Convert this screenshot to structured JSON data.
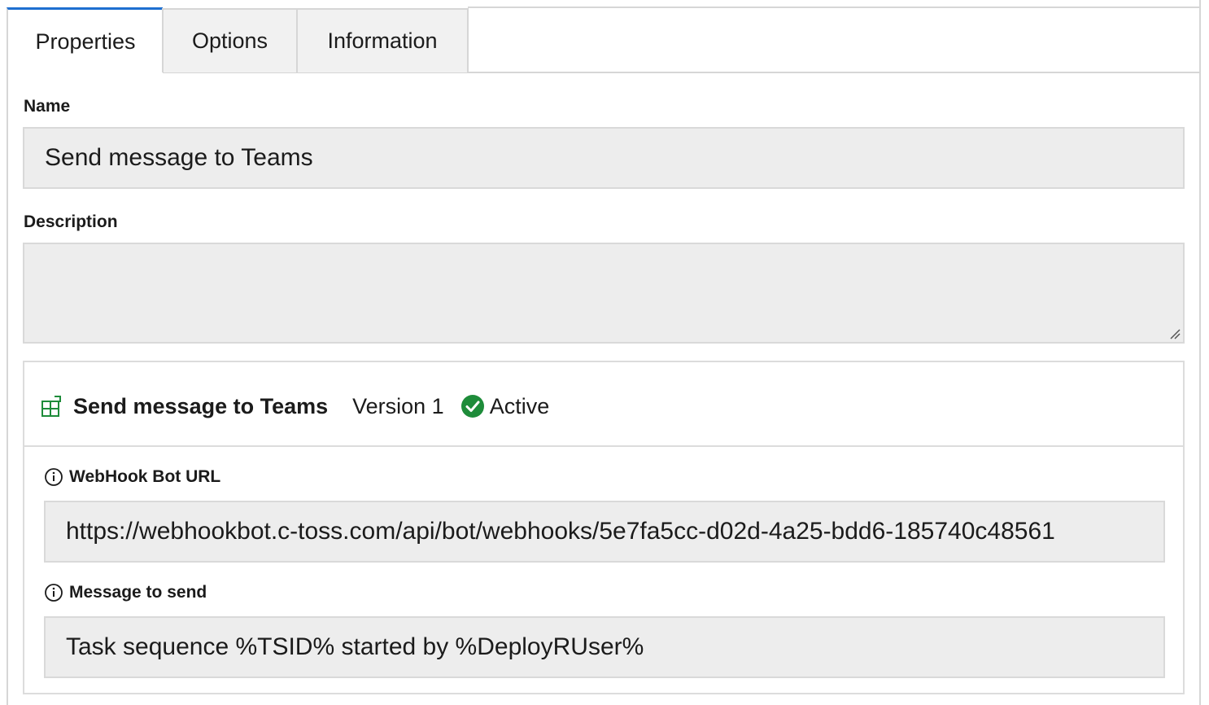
{
  "tabs": [
    {
      "label": "Properties",
      "active": true
    },
    {
      "label": "Options",
      "active": false
    },
    {
      "label": "Information",
      "active": false
    }
  ],
  "name_field": {
    "label": "Name",
    "value": "Send message to Teams"
  },
  "description_field": {
    "label": "Description",
    "value": ""
  },
  "step": {
    "icon": "package-icon",
    "title": "Send message to Teams",
    "version": "Version 1",
    "status": "Active",
    "status_color": "#1e8c3a",
    "parameters": [
      {
        "label": "WebHook Bot URL",
        "value": "https://webhookbot.c-toss.com/api/bot/webhooks/5e7fa5cc-d02d-4a25-bdd6-185740c48561"
      },
      {
        "label": "Message to send",
        "value": "Task sequence %TSID% started by %DeployRUser%"
      }
    ]
  },
  "colors": {
    "accent": "#1e6fd0",
    "input_bg": "#ededed",
    "border": "#d6d6d6"
  }
}
